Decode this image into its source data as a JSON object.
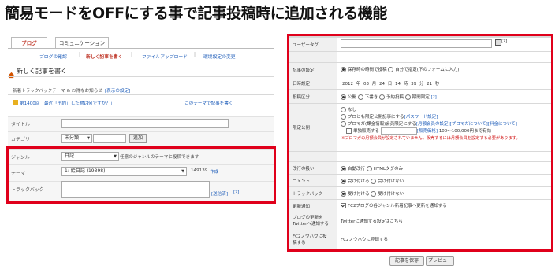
{
  "headline": "簡易モードをOFFにする事で記事投稿時に追加される機能",
  "tabs": [
    {
      "label": "ブログ",
      "active": true
    },
    {
      "label": "コミュニケーション",
      "active": false
    }
  ],
  "subnav": [
    {
      "label": "ブログの確認",
      "active": false
    },
    {
      "label": "新しく記事を書く",
      "active": true
    },
    {
      "label": "ファイルアップロード",
      "active": false
    },
    {
      "label": "環境設定の変更",
      "active": false
    }
  ],
  "page_title": "新しく記事を書く",
  "trackback_theme": {
    "label": "新着トラックバックテーマ & お得なお知らせ",
    "link": "[表示の設定]",
    "item": "第1400回「最近「予約」した物は何ですか？」",
    "item_link": "このテーマで記事を書く"
  },
  "fields": {
    "title_label": "タイトル",
    "category_label": "カテゴリ",
    "category_value": "未分類",
    "add_button": "追加",
    "genre_label": "ジャンル",
    "genre_value": "日記",
    "genre_note": "任意のジャンルのテーマに投稿できます",
    "theme_label": "テーマ",
    "theme_value": "1: 絵日記 (19398)",
    "theme_count": "149139",
    "theme_create": "作成",
    "trackback_label": "トラックバック",
    "trackback_send": "[送信済]",
    "trackback_help": "[?]"
  },
  "right": {
    "user_tag_label": "ユーザータグ",
    "user_tag_help": "[?]",
    "post_setting_label": "記事の設定",
    "post_setting_opt1": "保存時の時間で投稿",
    "post_setting_opt2": "自分で指定(下のフォームに入力)",
    "datetime_label": "日時設定",
    "datetime": {
      "year": "2012",
      "y": "年",
      "month": "03",
      "mo": "月",
      "day": "24",
      "d": "日",
      "hour": "14",
      "h": "時",
      "minute": "39",
      "mi": "分",
      "second": "21",
      "s": "秒"
    },
    "post_type_label": "投稿区分",
    "post_type_opts": [
      "公開",
      "下書き",
      "予約投稿",
      "期間限定"
    ],
    "post_type_help": "[?]",
    "limited_label": "限定公開",
    "limited_opt1": "なし",
    "limited_opt2a": "ブロとも限定公開記事にする",
    "limited_opt2b": "[パスワード設定]",
    "limited_opt3a": "ブロマガ(課金情報)会員限定にする",
    "limited_opt3b": "[月額会員の設定]",
    "limited_opt3c": "[ブロマガについて]",
    "limited_opt3d": "[料金について]",
    "limited_price_prefix": "単独販売する",
    "limited_price_link": "[販売価格]",
    "limited_price_range": "100〜100,000円まで有効",
    "limited_warn": "※ブロマガの月額会員が設定されていません。販売するには月額会員を設定する必要があります。",
    "linebreak_label": "改行の扱い",
    "linebreak_opts": [
      "自動改行",
      "HTMLタグのみ"
    ],
    "comment_label": "コメント",
    "comment_opts": [
      "受け付ける",
      "受け付けない"
    ],
    "trackback_label": "トラックバック",
    "trackback_opts": [
      "受け付ける",
      "受け付けない"
    ],
    "update_label": "更新通知",
    "update_text": "FC2ブログの各ジャンル新着記事へ更新を通知する",
    "twitter_label1": "ブログの更新を",
    "twitter_label2": "Twitterへ通知する",
    "twitter_link": "Twitterに通知する設定はこちら",
    "knowhow_label1": "FC2ノウハウに投",
    "knowhow_label2": "稿する",
    "knowhow_link": "FC2ノウハウに登録する"
  },
  "buttons": {
    "save": "記事を保存",
    "preview": "プレビュー"
  }
}
